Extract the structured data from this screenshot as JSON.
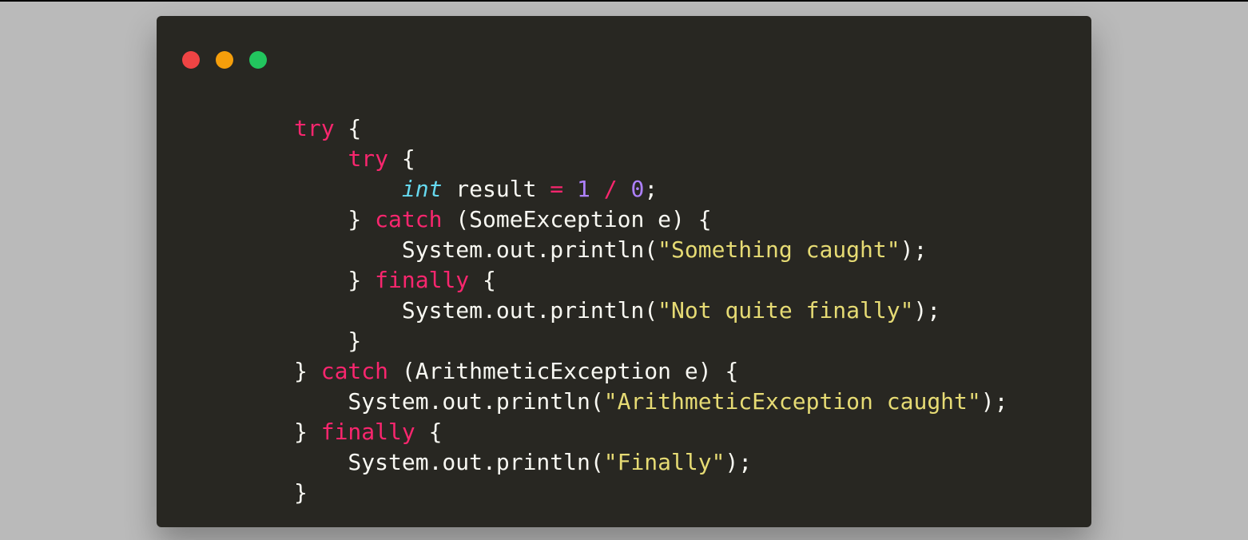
{
  "colors": {
    "close": "#ef4444",
    "minimize": "#f59e0b",
    "maximize": "#22c55e",
    "background": "#282722",
    "pageBackground": "#bababa"
  },
  "code": {
    "tokens": [
      [
        {
          "t": "keyword",
          "v": "try"
        },
        {
          "t": "default",
          "v": " {"
        }
      ],
      [
        {
          "t": "default",
          "v": "    "
        },
        {
          "t": "keyword",
          "v": "try"
        },
        {
          "t": "default",
          "v": " {"
        }
      ],
      [
        {
          "t": "default",
          "v": "        "
        },
        {
          "t": "type",
          "v": "int"
        },
        {
          "t": "default",
          "v": " result "
        },
        {
          "t": "keyword",
          "v": "="
        },
        {
          "t": "default",
          "v": " "
        },
        {
          "t": "number",
          "v": "1"
        },
        {
          "t": "default",
          "v": " "
        },
        {
          "t": "keyword",
          "v": "/"
        },
        {
          "t": "default",
          "v": " "
        },
        {
          "t": "number",
          "v": "0"
        },
        {
          "t": "default",
          "v": ";"
        }
      ],
      [
        {
          "t": "default",
          "v": "    } "
        },
        {
          "t": "keyword",
          "v": "catch"
        },
        {
          "t": "default",
          "v": " (SomeException e) {"
        }
      ],
      [
        {
          "t": "default",
          "v": "        System.out.println("
        },
        {
          "t": "string",
          "v": "\"Something caught\""
        },
        {
          "t": "default",
          "v": ");"
        }
      ],
      [
        {
          "t": "default",
          "v": "    } "
        },
        {
          "t": "keyword",
          "v": "finally"
        },
        {
          "t": "default",
          "v": " {"
        }
      ],
      [
        {
          "t": "default",
          "v": "        System.out.println("
        },
        {
          "t": "string",
          "v": "\"Not quite finally\""
        },
        {
          "t": "default",
          "v": ");"
        }
      ],
      [
        {
          "t": "default",
          "v": "    }"
        }
      ],
      [
        {
          "t": "default",
          "v": "} "
        },
        {
          "t": "keyword",
          "v": "catch"
        },
        {
          "t": "default",
          "v": " (ArithmeticException e) {"
        }
      ],
      [
        {
          "t": "default",
          "v": "    System.out.println("
        },
        {
          "t": "string",
          "v": "\"ArithmeticException caught\""
        },
        {
          "t": "default",
          "v": ");"
        }
      ],
      [
        {
          "t": "default",
          "v": "} "
        },
        {
          "t": "keyword",
          "v": "finally"
        },
        {
          "t": "default",
          "v": " {"
        }
      ],
      [
        {
          "t": "default",
          "v": "    System.out.println("
        },
        {
          "t": "string",
          "v": "\"Finally\""
        },
        {
          "t": "default",
          "v": ");"
        }
      ],
      [
        {
          "t": "default",
          "v": "}"
        }
      ]
    ]
  }
}
